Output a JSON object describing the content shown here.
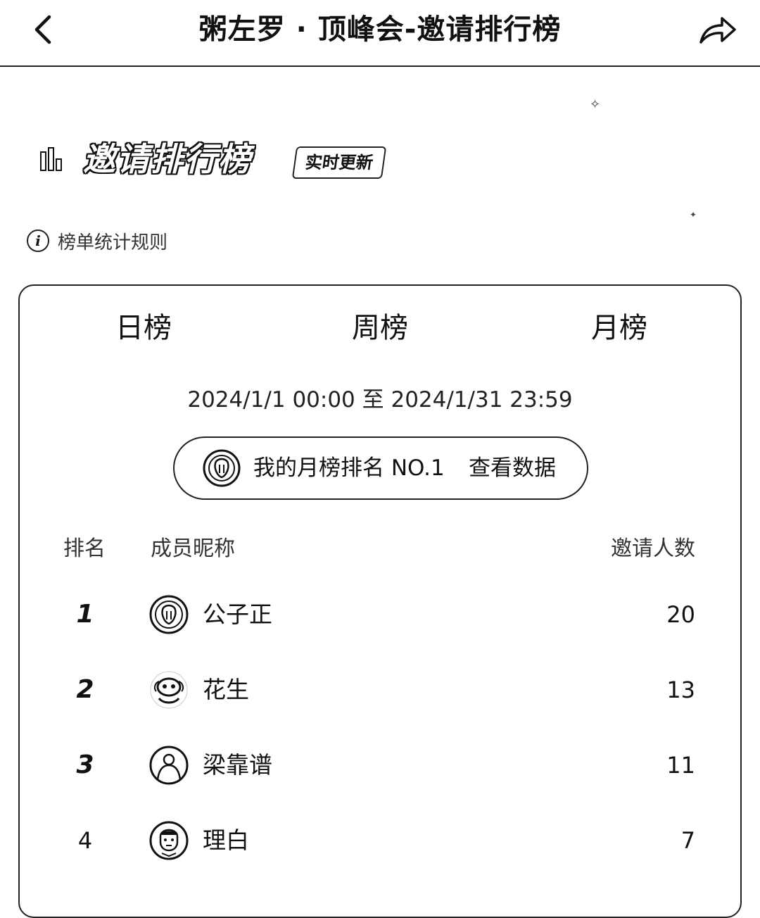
{
  "navbar": {
    "title": "粥左罗 · 顶峰会-邀请排行榜",
    "back_icon": "chevron-left-icon",
    "share_icon": "share-arrow-icon"
  },
  "hero": {
    "title": "邀请排行榜",
    "badge": "实时更新",
    "rules_label": "榜单统计规则"
  },
  "tabs": [
    {
      "label": "日榜"
    },
    {
      "label": "周榜"
    },
    {
      "label": "月榜"
    }
  ],
  "date_range": "2024/1/1 00:00 至 2024/1/31 23:59",
  "my_rank": {
    "text": "我的月榜排名 NO.1",
    "link": "查看数据"
  },
  "table": {
    "headers": {
      "rank": "排名",
      "name": "成员昵称",
      "count": "邀请人数"
    },
    "rows": [
      {
        "rank": "1",
        "name": "公子正",
        "count": "20"
      },
      {
        "rank": "2",
        "name": "花生",
        "count": "13"
      },
      {
        "rank": "3",
        "name": "梁靠谱",
        "count": "11"
      },
      {
        "rank": "4",
        "name": "理白",
        "count": "7"
      }
    ]
  }
}
